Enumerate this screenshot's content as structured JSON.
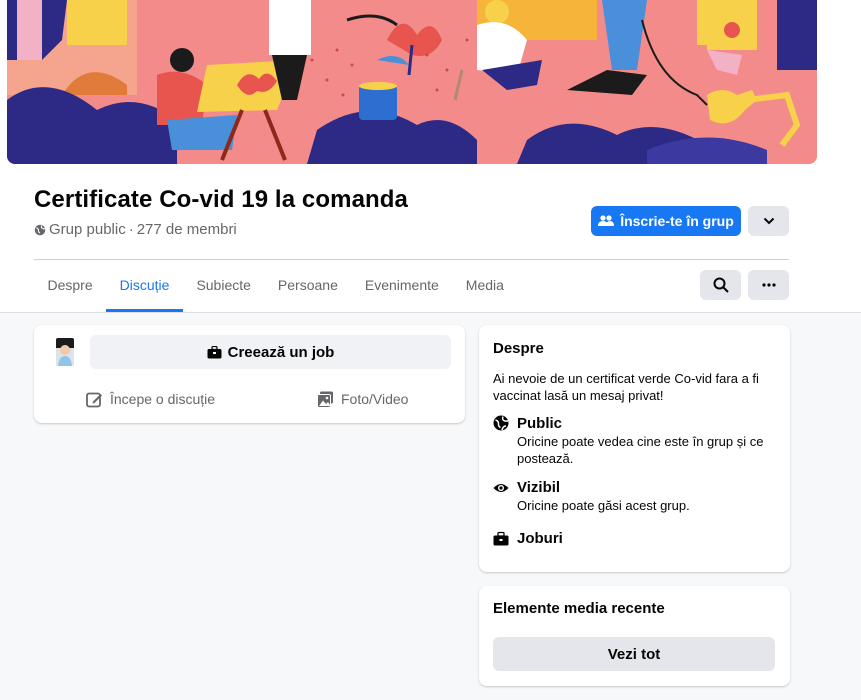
{
  "group": {
    "name": "Certificate Co-vid 19 la comanda",
    "privacy": "Grup public",
    "separator": "·",
    "members": "277 de membri"
  },
  "actions": {
    "join_label": "Înscrie-te în grup"
  },
  "tabs": [
    {
      "label": "Despre"
    },
    {
      "label": "Discuție"
    },
    {
      "label": "Subiecte"
    },
    {
      "label": "Persoane"
    },
    {
      "label": "Evenimente"
    },
    {
      "label": "Media"
    }
  ],
  "active_tab": "Discuție",
  "composer": {
    "create_job_label": "Creează un job",
    "start_discussion_label": "Începe o discuție",
    "photo_video_label": "Foto/Video"
  },
  "about": {
    "heading": "Despre",
    "description": "Ai nevoie de un certificat verde Co-vid fara a fi vaccinat lasă un mesaj privat!",
    "items": [
      {
        "icon": "globe-icon",
        "title": "Public",
        "desc": "Oricine poate vedea cine este în grup și ce postează."
      },
      {
        "icon": "eye-icon",
        "title": "Vizibil",
        "desc": "Oricine poate găsi acest grup."
      },
      {
        "icon": "briefcase-icon",
        "title": "Joburi",
        "desc": ""
      }
    ]
  },
  "media": {
    "heading": "Elemente media recente",
    "see_all_label": "Vezi tot"
  },
  "colors": {
    "accent": "#1877f2",
    "cover_pink": "#f38b8b",
    "cover_navy": "#2d2a86"
  }
}
